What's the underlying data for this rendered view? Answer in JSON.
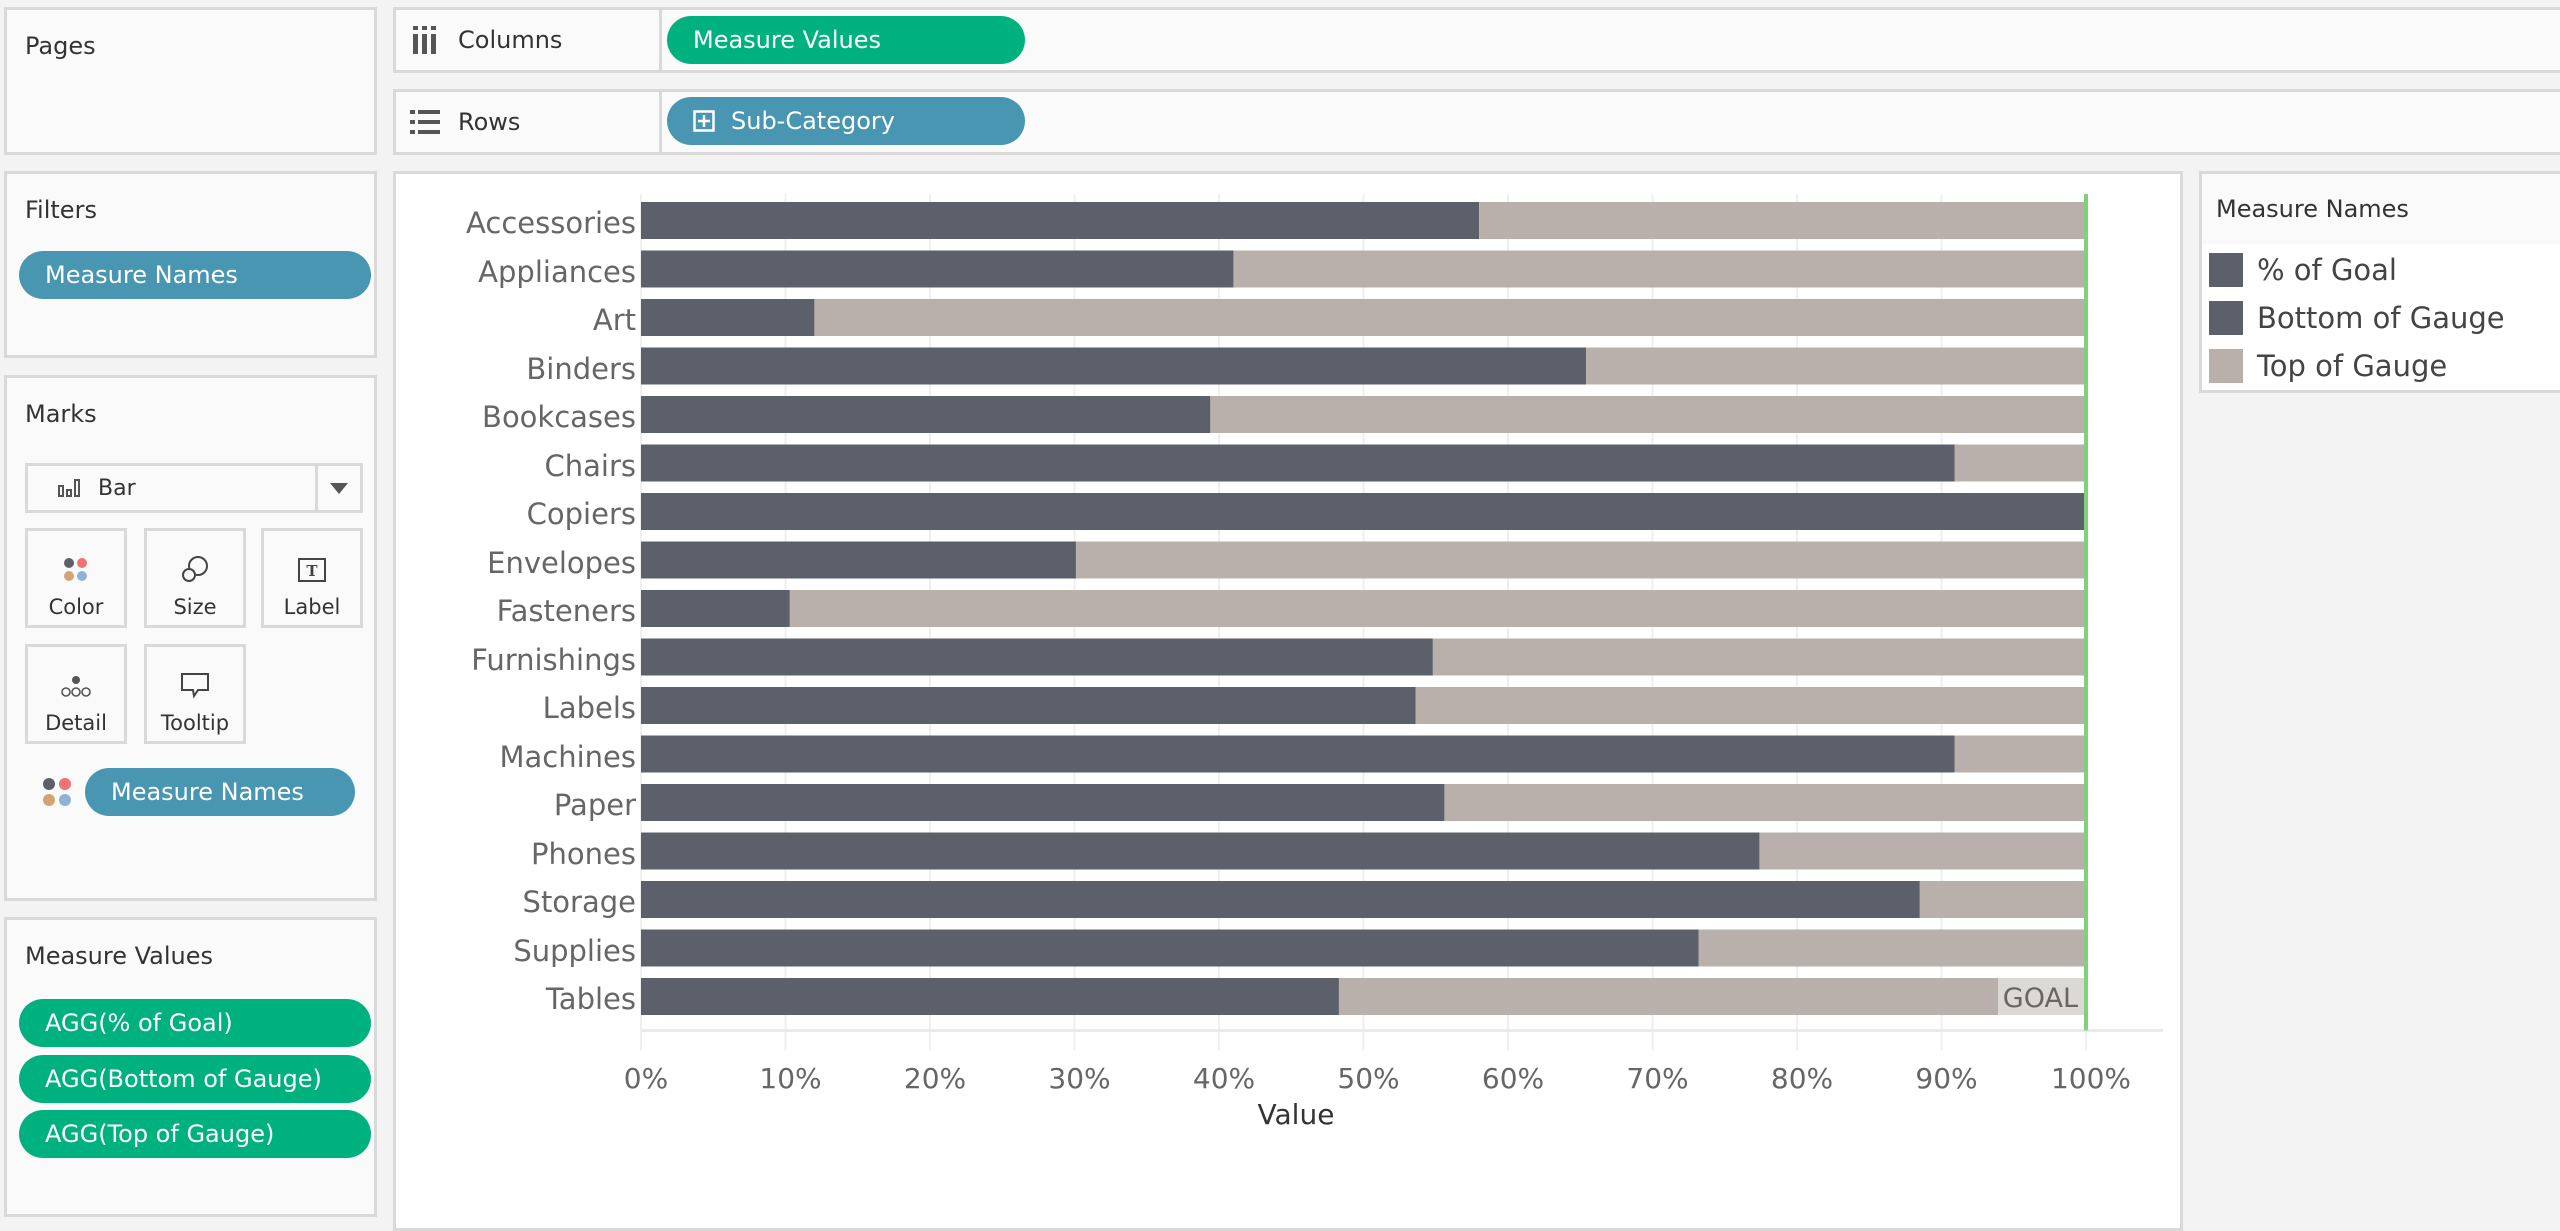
{
  "pages": {
    "title": "Pages"
  },
  "filters": {
    "title": "Filters",
    "pills": [
      "Measure Names"
    ]
  },
  "marks": {
    "title": "Marks",
    "mark_type": "Bar",
    "buttons": [
      {
        "label": "Color",
        "icon": "color-icon"
      },
      {
        "label": "Size",
        "icon": "size-icon"
      },
      {
        "label": "Label",
        "icon": "label-icon"
      },
      {
        "label": "Detail",
        "icon": "detail-icon"
      },
      {
        "label": "Tooltip",
        "icon": "tooltip-icon"
      }
    ],
    "color_pill": "Measure Names"
  },
  "measure_values": {
    "title": "Measure Values",
    "pills": [
      "AGG(% of Goal)",
      "AGG(Bottom of Gauge)",
      "AGG(Top of Gauge)"
    ]
  },
  "shelves": {
    "columns": {
      "label": "Columns",
      "pill": "Measure Values"
    },
    "rows": {
      "label": "Rows",
      "pill": "Sub-Category"
    }
  },
  "legend": {
    "title": "Measure Names",
    "items": [
      {
        "label": "% of Goal",
        "color": "#5b606a"
      },
      {
        "label": "Bottom of Gauge",
        "color": "#5b606a"
      },
      {
        "label": "Top of Gauge",
        "color": "#b9b0ab"
      }
    ]
  },
  "colors": {
    "pct_of_goal": "#5b606a",
    "top_of_gauge": "#b9b0ab",
    "goal_line": "#7fd17a",
    "pill_green": "#00b180",
    "pill_blue": "#4996b2"
  },
  "chart_data": {
    "type": "bar",
    "orientation": "horizontal",
    "stacked": true,
    "categories": [
      "Accessories",
      "Appliances",
      "Art",
      "Binders",
      "Bookcases",
      "Chairs",
      "Copiers",
      "Envelopes",
      "Fasteners",
      "Furnishings",
      "Labels",
      "Machines",
      "Paper",
      "Phones",
      "Storage",
      "Supplies",
      "Tables"
    ],
    "series": [
      {
        "name": "% of Goal",
        "values": [
          58.0,
          41.0,
          12.0,
          65.4,
          39.4,
          90.9,
          100.0,
          30.1,
          10.3,
          54.8,
          53.6,
          90.9,
          55.6,
          77.4,
          88.5,
          73.2,
          48.3
        ]
      },
      {
        "name": "Top of Gauge",
        "values": [
          42.0,
          59.0,
          88.0,
          34.6,
          60.6,
          9.1,
          0.0,
          69.9,
          89.7,
          45.2,
          46.4,
          9.1,
          44.4,
          22.6,
          11.5,
          26.8,
          51.7
        ]
      }
    ],
    "xlabel": "Value",
    "ylabel": "",
    "xlim": [
      0,
      100
    ],
    "x_ticks": [
      "0%",
      "10%",
      "20%",
      "30%",
      "40%",
      "50%",
      "60%",
      "70%",
      "80%",
      "90%",
      "100%"
    ],
    "reference_line": {
      "value": 100,
      "label": "GOAL"
    },
    "grid": true,
    "legend_position": "right"
  }
}
